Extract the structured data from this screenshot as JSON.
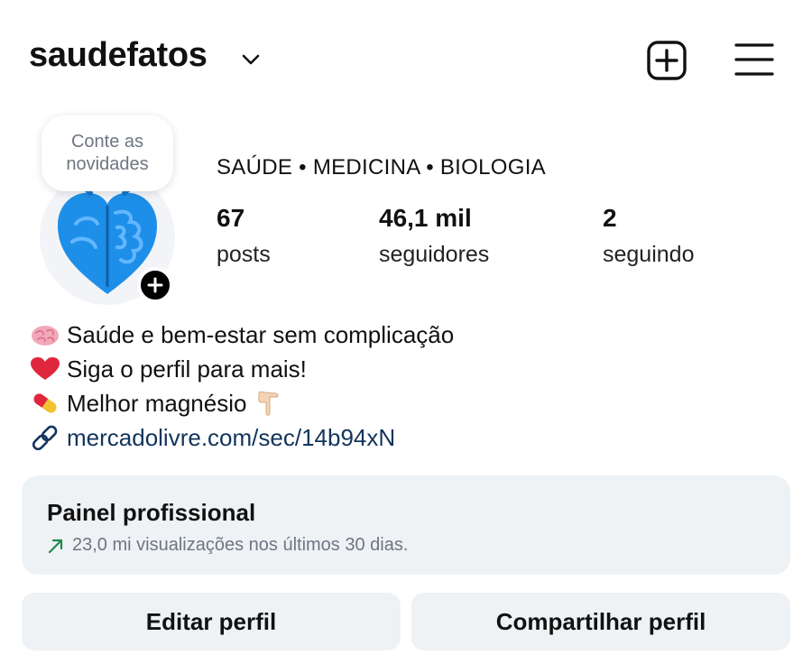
{
  "header": {
    "username": "saudefatos",
    "icons": [
      "chevron-down-icon",
      "new-post-icon",
      "menu-icon"
    ]
  },
  "profile": {
    "note": "Conte as novidades",
    "category": "SAÚDE • MEDICINA • BIOLOGIA",
    "stats": [
      {
        "value": "67",
        "label": "posts"
      },
      {
        "value": "46,1 mil",
        "label": "seguidores"
      },
      {
        "value": "2",
        "label": "seguindo"
      }
    ]
  },
  "bio": {
    "lines": [
      {
        "icon": "brain-emoji",
        "text": "Saúde e bem-estar sem complicação"
      },
      {
        "icon": "heart-emoji",
        "text": "Siga o perfil para mais!"
      },
      {
        "icon": "pill-emoji",
        "text": "Melhor magnésio",
        "trailing_icon": "pointing-down-emoji"
      }
    ],
    "link": {
      "icon": "link-icon",
      "text": "mercadolivre.com/sec/14b94xN"
    }
  },
  "dashboard": {
    "title": "Painel profissional",
    "subtitle": "23,0 mi visualizações nos últimos 30 dias.",
    "trend_color": "#1f8a4c"
  },
  "actions": {
    "edit": "Editar perfil",
    "share": "Compartilhar perfil"
  },
  "colors": {
    "link": "#12345c",
    "panel_bg": "#eff2f5",
    "avatar_brain": "#1e8fe8"
  }
}
